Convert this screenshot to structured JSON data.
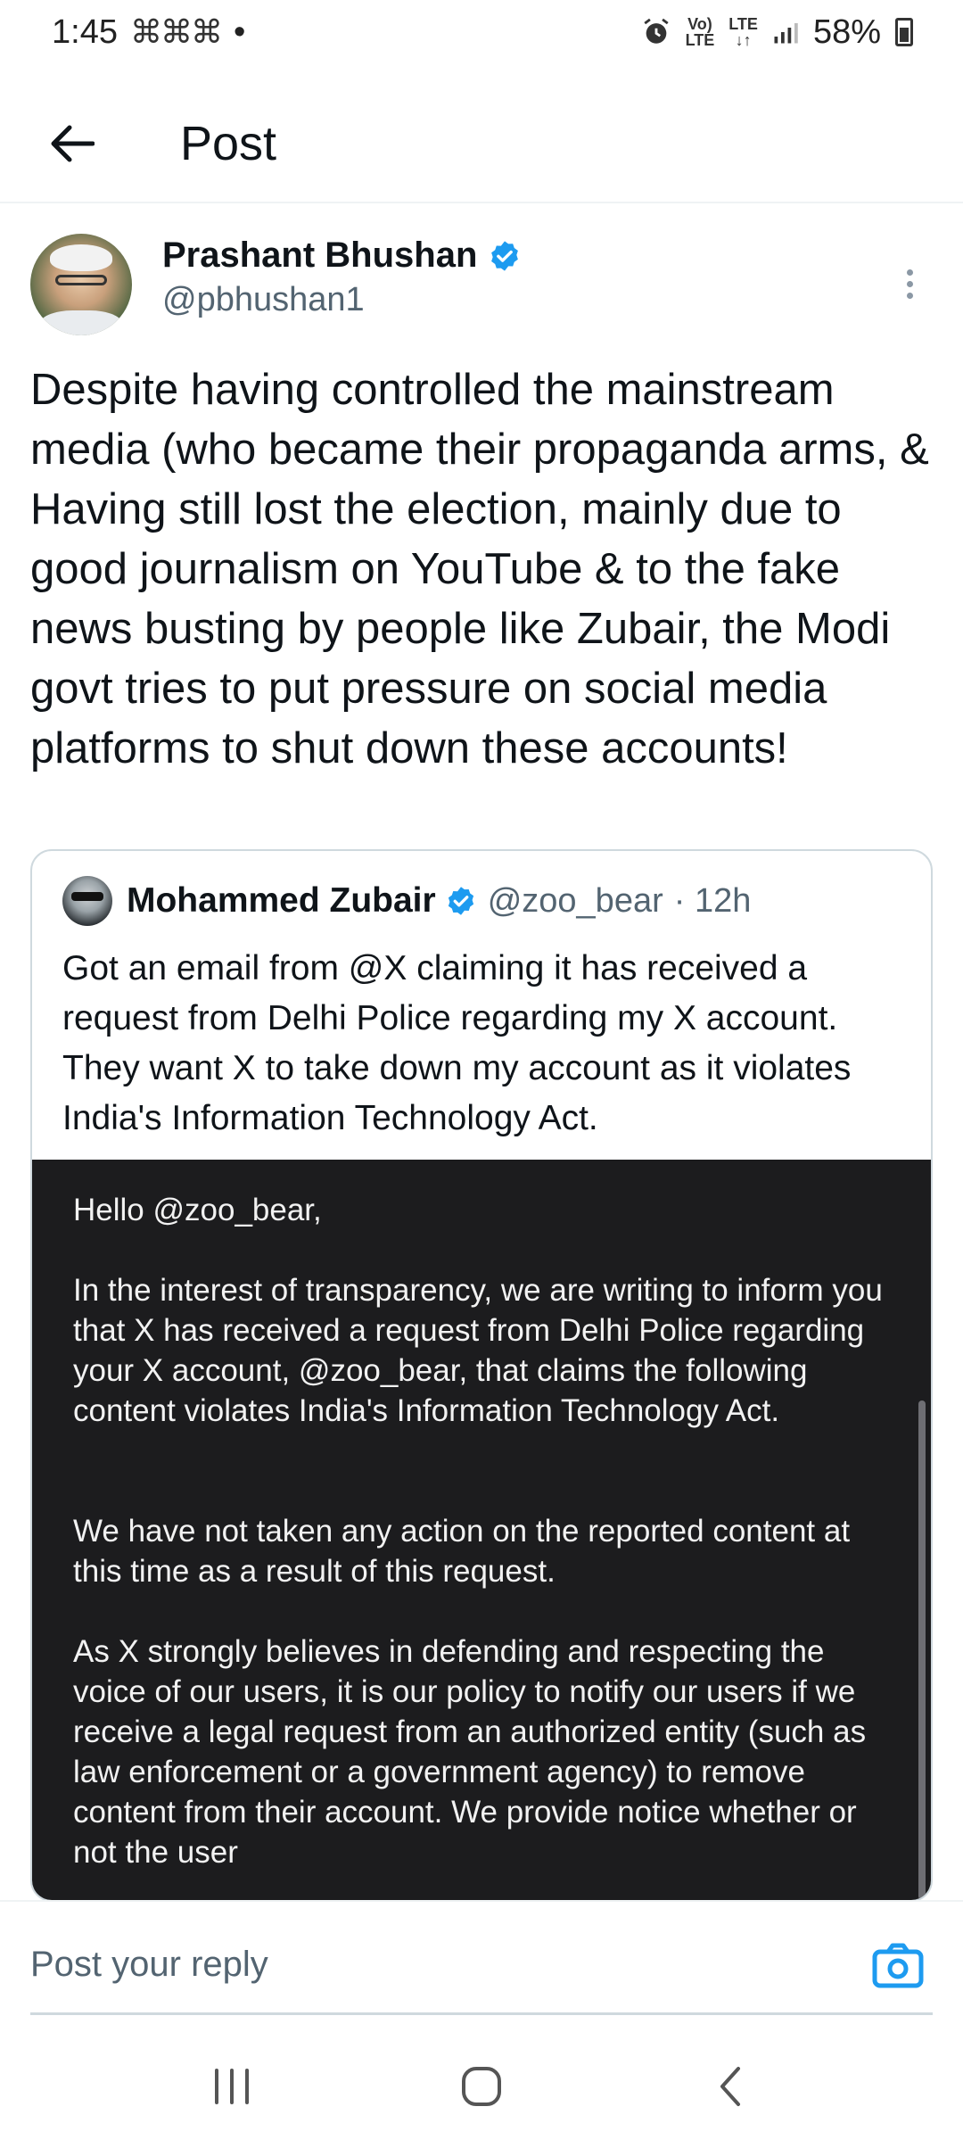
{
  "status_bar": {
    "time": "1:45",
    "notif_icons": "⌘⌘⌘",
    "dot": "•",
    "volte_top": "Vo)",
    "volte_bottom": "LTE",
    "lte_top": "LTE",
    "lte_bottom": "↓↑",
    "battery": "58%"
  },
  "header": {
    "title": "Post"
  },
  "post": {
    "author_name": "Prashant Bhushan",
    "author_handle": "@pbhushan1",
    "verified": true,
    "text": "Despite having controlled the mainstream media (who became their propaganda arms, & Having still lost the election, mainly due to good journalism on YouTube & to the fake news busting by people like Zubair, the Modi govt tries to put pressure on social media platforms to shut down these accounts!"
  },
  "quoted_post": {
    "author_name": "Mohammed Zubair",
    "author_handle": "@zoo_bear",
    "time": "· 12h",
    "verified": true,
    "text": "Got an email from @X claiming it has received a request from Delhi Police regarding my X account. They want X to take down my account as it violates India's Information Technology Act.",
    "image_text": {
      "greeting": "Hello @zoo_bear,",
      "para1": "In the interest of transparency, we are writing to inform you that X has received a request from Delhi Police regarding your X account, @zoo_bear, that claims the following content violates India's Information Technology Act.",
      "para2": "We have not taken any action on the reported content at this time as a result of this request.",
      "para3": "As X strongly believes in defending and respecting the voice of our users, it is our policy to notify our users if we receive a legal request from an authorized entity (such as law enforcement or a government agency) to remove content from their account. We provide notice whether or not the user"
    }
  },
  "reply": {
    "placeholder": "Post your reply"
  },
  "colors": {
    "accent": "#1d9bf0",
    "text": "#0f1419",
    "secondary": "#536471"
  }
}
